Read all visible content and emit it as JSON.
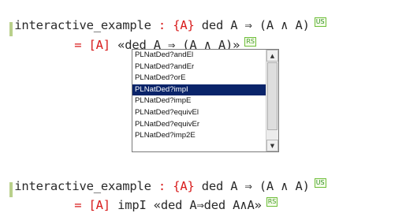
{
  "editor": {
    "line1": {
      "keyword": "interactive_example",
      "colon": " : ",
      "ctx": "{A}",
      "rest": " ded A ⇒ (A ∧ A)",
      "badge": "US"
    },
    "line2": {
      "eq": "= ",
      "ctx": "[A]",
      "rest": " «ded A ⇒ (A ∧ A)»",
      "badge": "RS"
    },
    "line3": {
      "keyword": "interactive_example",
      "colon": " : ",
      "ctx": "{A}",
      "rest": " ded A ⇒ (A ∧ A)",
      "badge": "US"
    },
    "line4": {
      "eq": "= ",
      "ctx": "[A]",
      "rest": " impI «ded A⇒ded A∧A»",
      "badge": "RS"
    }
  },
  "completion": {
    "items": [
      "PLNatDed?andEl",
      "PLNatDed?andEr",
      "PLNatDed?orE",
      "PLNatDed?impI",
      "PLNatDed?impE",
      "PLNatDed?equivEl",
      "PLNatDed?equivEr",
      "PLNatDed?imp2E"
    ],
    "selected_index": 3,
    "scrollbar": {
      "up_icon": "▲",
      "down_icon": "▼"
    }
  },
  "colors": {
    "context_red": "#d81b1b",
    "selection": "#0a246a",
    "badge_green": "#2f8f1e",
    "gutter_green": "#b9d08b"
  }
}
